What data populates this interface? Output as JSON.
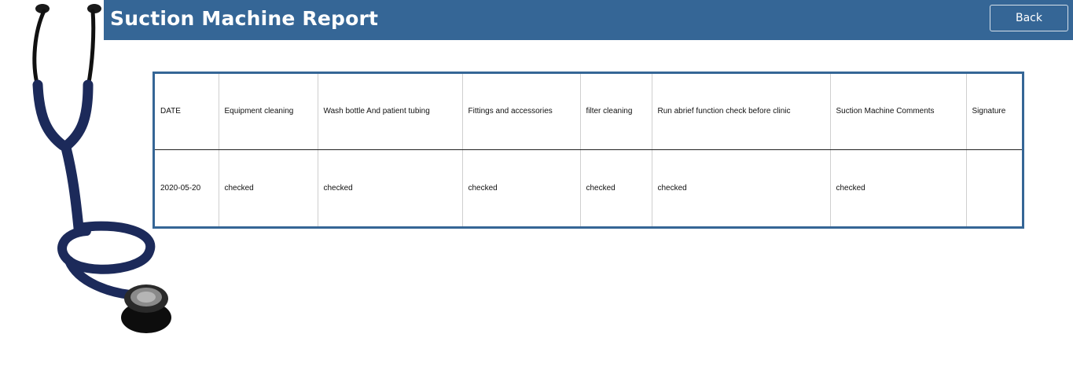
{
  "header": {
    "title": "Suction Machine Report",
    "back_label": "Back",
    "bg_color": "#356696"
  },
  "decoration": {
    "image": "stethoscope-icon"
  },
  "table": {
    "columns": [
      "DATE",
      "Equipment cleaning",
      "Wash bottle And patient tubing",
      "Fittings and accessories",
      "filter cleaning",
      "Run abrief function check before clinic",
      "Suction Machine Comments",
      "Signature"
    ],
    "rows": [
      [
        "2020-05-20",
        "checked",
        "checked",
        "checked",
        "checked",
        "checked",
        "checked",
        ""
      ]
    ]
  }
}
